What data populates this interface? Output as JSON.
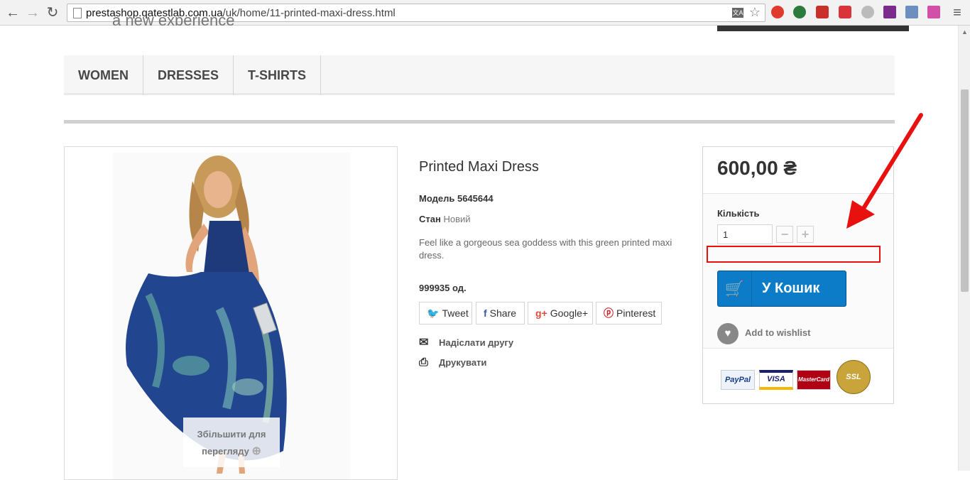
{
  "browser": {
    "url_prefix": "prestashop.qatestlab.com.ua",
    "url_path": "/uk/home/11-printed-maxi-dress.html"
  },
  "header": {
    "tagline": "a new experience"
  },
  "menu": {
    "items": [
      {
        "label": "WOMEN"
      },
      {
        "label": "DRESSES"
      },
      {
        "label": "T-SHIRTS"
      }
    ]
  },
  "image": {
    "zoom_label": "Збільшити для перегляду"
  },
  "product": {
    "title": "Printed Maxi Dress",
    "ref_label": "Модель",
    "ref_value": "5645644",
    "condition_label": "Стан",
    "condition_value": "Новий",
    "description": "Feel like a gorgeous sea goddess with this green printed maxi dress.",
    "quantity_available": "999935 од.",
    "social": {
      "tweet": "Tweet",
      "share": "Share",
      "google": "Google+",
      "pinterest": "Pinterest"
    },
    "send_to_friend": "Надіслати другу",
    "print": "Друкувати"
  },
  "buy_box": {
    "price": "600,00 ₴",
    "quantity_label": "Кількість",
    "quantity_value": "1",
    "add_to_cart": "У Кошик",
    "wishlist": "Add to wishlist",
    "payment_cards": [
      "PayPal",
      "VISA",
      "MasterCard",
      "SSL"
    ]
  },
  "colors": {
    "accent_blue": "#0c7bc8",
    "annotation_red": "#e8110f"
  }
}
